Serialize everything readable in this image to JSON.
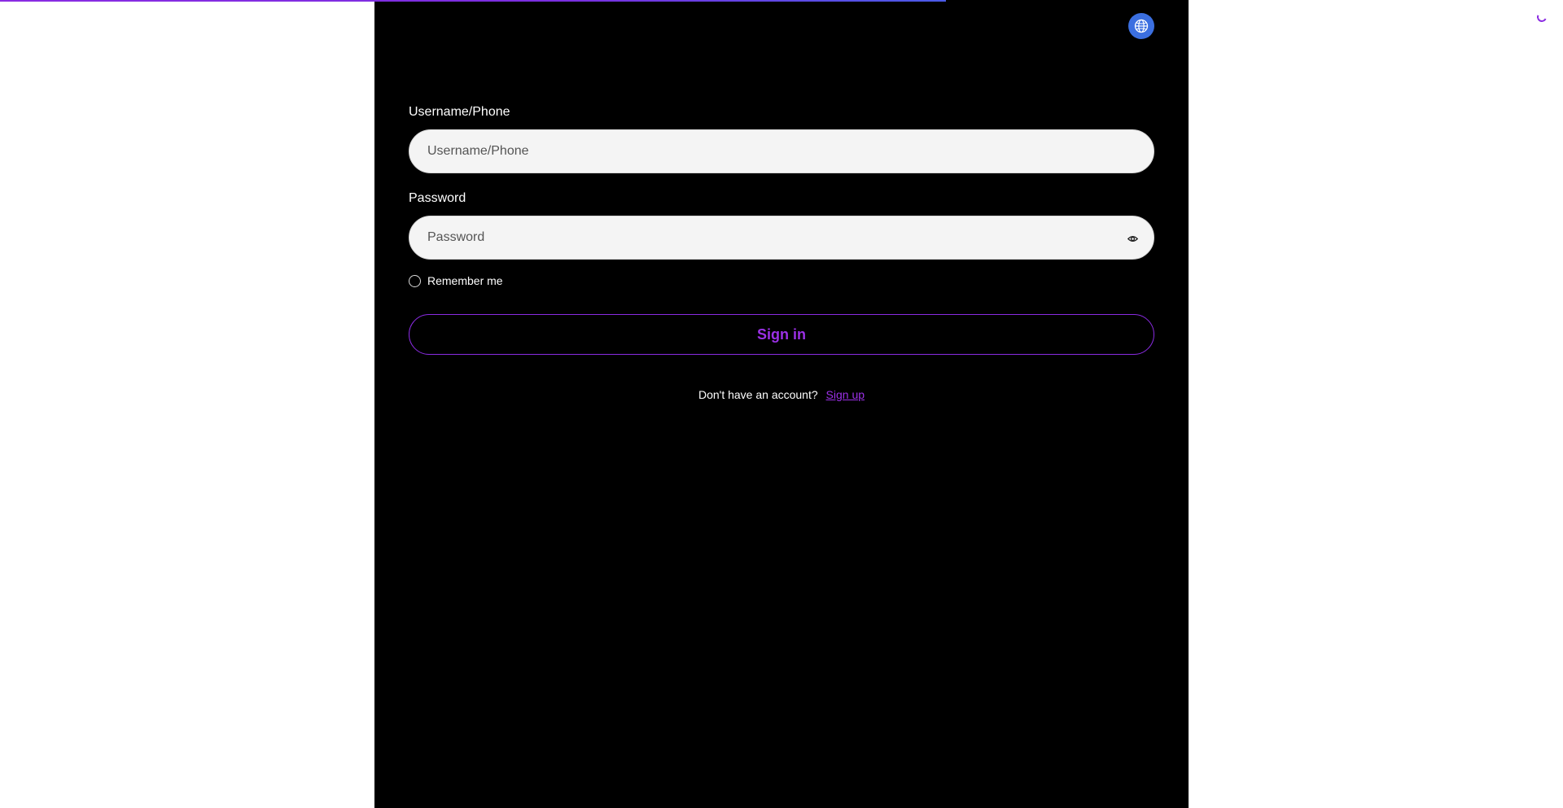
{
  "page": {
    "progress_fraction": 0.605,
    "accent_color": "#8a2be2",
    "lang_button_color": "#3b6fe0",
    "lang_icon": "globe-icon",
    "loading_icon": "spinner-icon"
  },
  "form": {
    "username": {
      "label": "Username/Phone",
      "placeholder": "Username/Phone",
      "value": ""
    },
    "password": {
      "label": "Password",
      "placeholder": "Password",
      "value": "",
      "toggle_icon": "eye-icon"
    },
    "remember_label": "Remember me",
    "remember_checked": false,
    "signin_label": "Sign in"
  },
  "signup": {
    "prompt": "Don't have an account?",
    "link_label": "Sign up"
  }
}
